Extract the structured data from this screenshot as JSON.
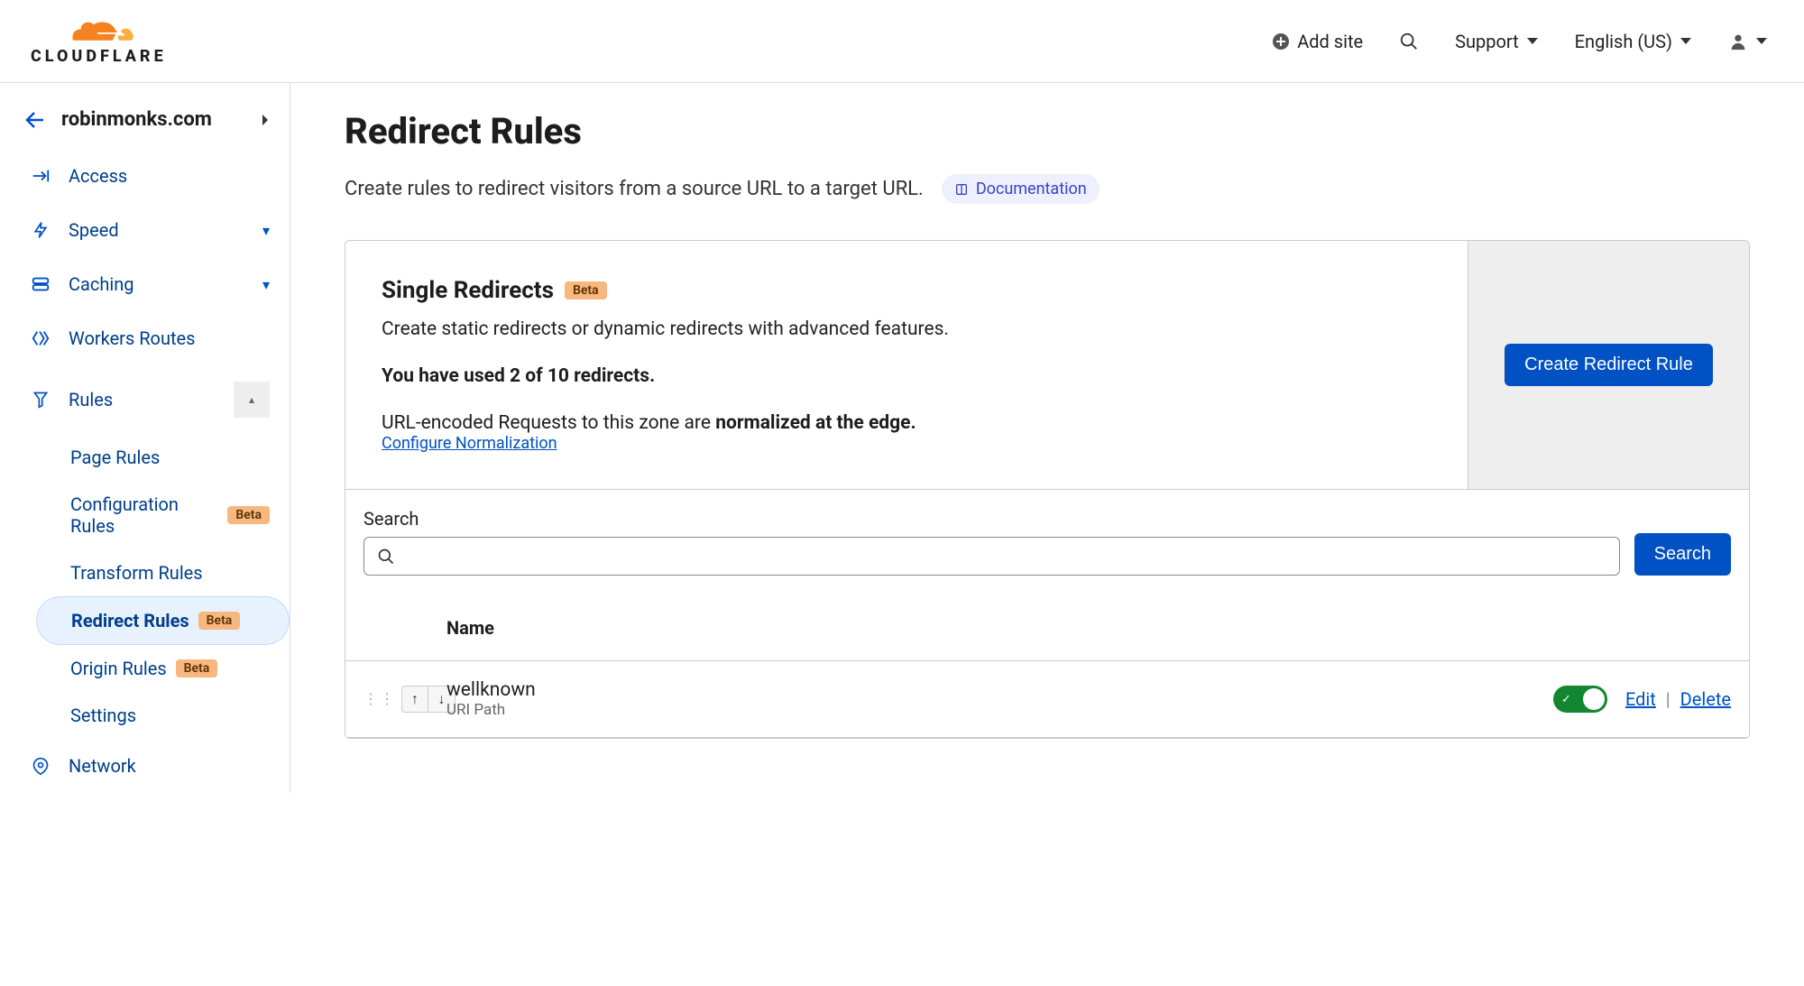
{
  "brand": "CLOUDFLARE",
  "header": {
    "add_site": "Add site",
    "support": "Support",
    "language": "English (US)"
  },
  "sidebar": {
    "domain": "robinmonks.com",
    "items": [
      {
        "label": "Access",
        "expandable": false
      },
      {
        "label": "Speed",
        "expandable": true
      },
      {
        "label": "Caching",
        "expandable": true
      },
      {
        "label": "Workers Routes",
        "expandable": false
      },
      {
        "label": "Rules",
        "expandable": true,
        "open": true
      },
      {
        "label": "Network",
        "expandable": false
      }
    ],
    "rules_sub": [
      {
        "label": "Page Rules",
        "beta": false
      },
      {
        "label": "Configuration Rules",
        "beta": true
      },
      {
        "label": "Transform Rules",
        "beta": false
      },
      {
        "label": "Redirect Rules",
        "beta": true,
        "active": true
      },
      {
        "label": "Origin Rules",
        "beta": true
      },
      {
        "label": "Settings",
        "beta": false
      }
    ],
    "beta_label": "Beta"
  },
  "page": {
    "title": "Redirect Rules",
    "subtitle": "Create rules to redirect visitors from a source URL to a target URL.",
    "doc_label": "Documentation"
  },
  "card": {
    "title": "Single Redirects",
    "desc": "Create static redirects or dynamic redirects with advanced features.",
    "stat": "You have used 2 of 10 redirects.",
    "norm_prefix": "URL-encoded Requests to this zone are ",
    "norm_strong": "normalized at the edge.",
    "configure_link": "Configure Normalization",
    "create_button": "Create Redirect Rule"
  },
  "search": {
    "label": "Search",
    "button": "Search",
    "placeholder": ""
  },
  "table": {
    "col_name": "Name",
    "rows": [
      {
        "name": "wellknown",
        "sub": "URI Path",
        "enabled": true
      }
    ],
    "edit": "Edit",
    "delete": "Delete"
  }
}
